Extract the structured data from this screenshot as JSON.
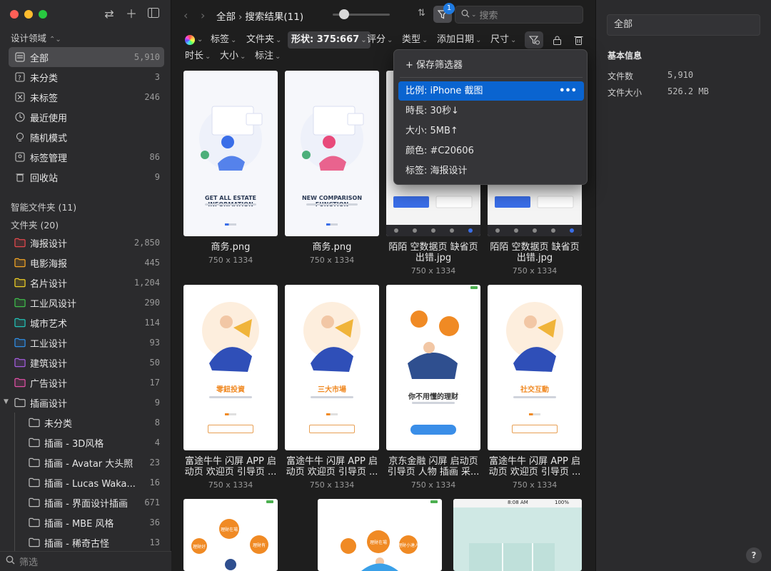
{
  "sidebar": {
    "library_label": "设计领域",
    "items": [
      {
        "label": "全部",
        "count": "5,910"
      },
      {
        "label": "未分类",
        "count": "3"
      },
      {
        "label": "未标签",
        "count": "246"
      },
      {
        "label": "最近使用",
        "count": ""
      },
      {
        "label": "随机模式",
        "count": ""
      },
      {
        "label": "标签管理",
        "count": "86"
      },
      {
        "label": "回收站",
        "count": "9"
      }
    ],
    "smart_folders_title": "智能文件夹 (11)",
    "folders_title": "文件夹 (20)",
    "folders": [
      {
        "label": "海报设计",
        "count": "2,850",
        "color": "#e5484d"
      },
      {
        "label": "电影海报",
        "count": "445",
        "color": "#f5a524"
      },
      {
        "label": "名片设计",
        "count": "1,204",
        "color": "#f2d024"
      },
      {
        "label": "工业风设计",
        "count": "290",
        "color": "#3fbf4a"
      },
      {
        "label": "城市艺术",
        "count": "114",
        "color": "#22c3b8"
      },
      {
        "label": "工业设计",
        "count": "93",
        "color": "#2f8fe8"
      },
      {
        "label": "建筑设计",
        "count": "50",
        "color": "#a55ce0"
      },
      {
        "label": "广告设计",
        "count": "17",
        "color": "#e24fa6"
      },
      {
        "label": "插画设计",
        "count": "9",
        "color": "#bdbdbd"
      }
    ],
    "subfolders": [
      {
        "label": "未分类",
        "count": "8"
      },
      {
        "label": "插画 - 3D风格",
        "count": "4"
      },
      {
        "label": "插画 - Avatar 大头照",
        "count": "23"
      },
      {
        "label": "插画 - Lucas Waka...",
        "count": "16"
      },
      {
        "label": "插画 - 界面设计插画",
        "count": "671"
      },
      {
        "label": "插画 - MBE 风格",
        "count": "36"
      },
      {
        "label": "插画 - 稀奇古怪",
        "count": "13"
      }
    ],
    "filter_placeholder": "筛选"
  },
  "toolbar": {
    "crumb_root": "全部",
    "crumb_current": "搜索结果(11)",
    "filter_badge": "1",
    "search_placeholder": "搜索",
    "zoom_level": 0.2
  },
  "filters": {
    "row1": [
      "标签",
      "文件夹",
      "形状: 375:667",
      "评分",
      "类型",
      "添加日期",
      "尺寸"
    ],
    "row2": [
      "时长",
      "大小",
      "标注"
    ]
  },
  "dropdown": {
    "save_label": "+ 保存筛选器",
    "items": [
      "比例: iPhone 截图",
      "時長: 30秒↓",
      "大小: 5MB↑",
      "颜色: #C20606",
      "标签: 海报设计"
    ],
    "more": "•••"
  },
  "grid": {
    "cards": [
      {
        "title": "商务.png",
        "size": "750 x 1334",
        "caption": "GET ALL ESTATE INFORMATION",
        "accent": "#3a6ee8"
      },
      {
        "title": "商务.png",
        "size": "750 x 1334",
        "caption": "NEW COMPARISON FUNCTION",
        "accent": "#e84a7a"
      },
      {
        "title": "陌陌 空数据页 缺省页 出错.jpg",
        "size": "750 x 1334",
        "caption": "",
        "accent": "#3a6ee8"
      },
      {
        "title": "陌陌 空数据页 缺省页 出错.jpg",
        "size": "750 x 1334",
        "caption": "",
        "accent": "#3a6ee8"
      },
      {
        "title": "富途牛牛 闪屏 APP 启动页 欢迎页 引导页 ...",
        "size": "750 x 1334",
        "caption": "零鈕投資",
        "accent": "#f08a24"
      },
      {
        "title": "富途牛牛 闪屏 APP 启动页 欢迎页 引导页 ...",
        "size": "750 x 1334",
        "caption": "三大市場",
        "accent": "#f08a24"
      },
      {
        "title": "京东金融 闪屏 启动页 引导页 人物 插画 采...",
        "size": "750 x 1334",
        "caption": "你不用懂的理财",
        "accent": "#f08a24"
      },
      {
        "title": "富途牛牛 闪屏 APP 启动页 欢迎页 引导页 ...",
        "size": "750 x 1334",
        "caption": "社交互動",
        "accent": "#f08a24"
      }
    ],
    "partial": [
      {
        "label_a": "理財在場",
        "label_b": "理財有",
        "label_c": "理財好"
      },
      {
        "label_a": "理財在場",
        "label_b": "理財小達人",
        "label_c": ""
      },
      {
        "status_time": "8:08 AM",
        "status_batt": "100%"
      }
    ]
  },
  "inspector": {
    "name_value": "全部",
    "heading": "基本信息",
    "rows": [
      {
        "label": "文件数",
        "value": "5,910"
      },
      {
        "label": "文件大小",
        "value": "526.2 MB"
      }
    ],
    "help": "?"
  }
}
